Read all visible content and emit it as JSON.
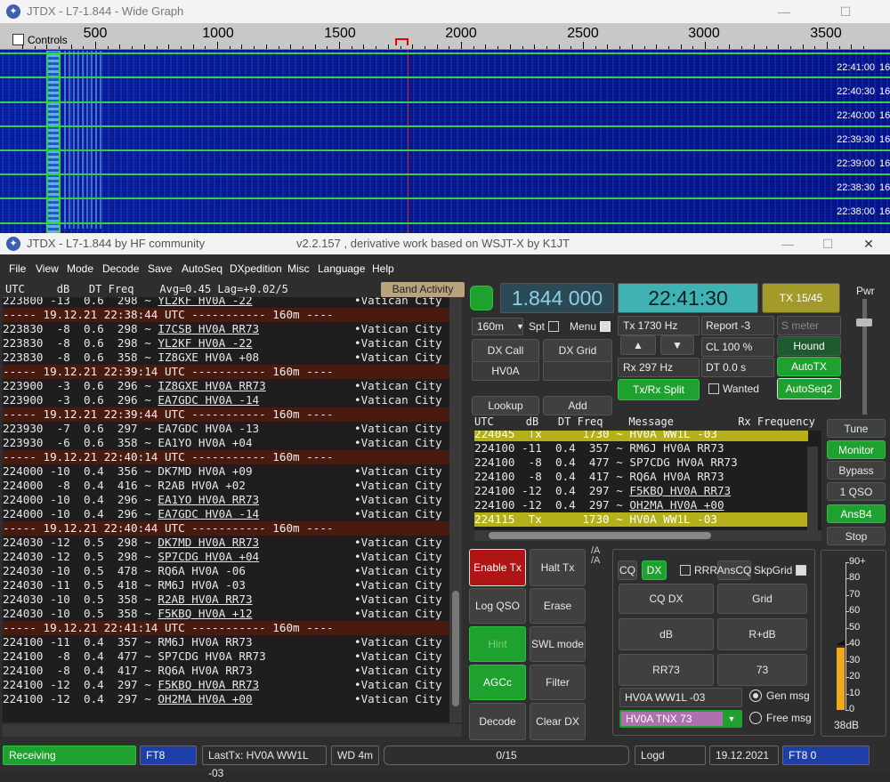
{
  "wide_graph": {
    "title": "JTDX - L7-1.844 - Wide Graph",
    "controls_label": "Controls",
    "scale_labels": [
      "500",
      "1000",
      "1500",
      "2000",
      "2500",
      "3000",
      "3500"
    ],
    "times": [
      "22:41:00",
      "22:40:30",
      "22:40:00",
      "22:39:30",
      "22:39:00",
      "22:38:30",
      "22:38:00"
    ],
    "time_suffix": "16"
  },
  "main": {
    "title": "JTDX - L7-1.844  by HF community",
    "version": "v2.2.157 , derivative work based on WSJT-X by K1JT",
    "menu": [
      "File",
      "View",
      "Mode",
      "Decode",
      "Save",
      "AutoSeq",
      "DXpedition",
      "Misc",
      "Language",
      "Help"
    ],
    "left_header": "UTC     dB   DT Freq    Avg=0.45 Lag=+0.02/5",
    "band_activity": "Band Activity",
    "left_rows": [
      {
        "t": "line",
        "text": "223800 -13  0.6  298 ~ ",
        "msg": "YL2KF HV0A -22",
        "cty": "•Vatican City"
      },
      {
        "t": "sep",
        "text": "----- 19.12.21 22:38:44 UTC ----------- 160m ----"
      },
      {
        "t": "line",
        "text": "223830  -8  0.6  298 ~ ",
        "msg": "I7CSB HV0A RR73",
        "cty": "•Vatican City"
      },
      {
        "t": "line",
        "text": "223830  -8  0.6  298 ~ ",
        "msg": "YL2KF HV0A -22",
        "cty": "•Vatican City"
      },
      {
        "t": "line",
        "text": "223830  -8  0.6  358 ~ IZ8GXE HV0A +08",
        "msg": "",
        "cty": "•Vatican City"
      },
      {
        "t": "sep",
        "text": "----- 19.12.21 22:39:14 UTC ----------- 160m ----"
      },
      {
        "t": "line",
        "text": "223900  -3  0.6  296 ~ ",
        "msg": "IZ8GXE HV0A RR73",
        "cty": "•Vatican City"
      },
      {
        "t": "line",
        "text": "223900  -3  0.6  296 ~ ",
        "msg": "EA7GDC HV0A -14",
        "cty": "•Vatican City"
      },
      {
        "t": "sep",
        "text": "----- 19.12.21 22:39:44 UTC ----------- 160m ----"
      },
      {
        "t": "line",
        "text": "223930  -7  0.6  297 ~ EA7GDC HV0A -13",
        "msg": "",
        "cty": "•Vatican City"
      },
      {
        "t": "line",
        "text": "223930  -6  0.6  358 ~ EA1YO HV0A +04",
        "msg": "",
        "cty": "•Vatican City"
      },
      {
        "t": "sep",
        "text": "----- 19.12.21 22:40:14 UTC ----------- 160m ----"
      },
      {
        "t": "line",
        "text": "224000 -10  0.4  356 ~ DK7MD HV0A +09",
        "msg": "",
        "cty": "•Vatican City"
      },
      {
        "t": "line",
        "text": "224000  -8  0.4  416 ~ R2AB HV0A +02",
        "msg": "",
        "cty": "•Vatican City"
      },
      {
        "t": "line",
        "text": "224000 -10  0.4  296 ~ ",
        "msg": "EA1YO HV0A RR73",
        "cty": "•Vatican City"
      },
      {
        "t": "line",
        "text": "224000 -10  0.4  296 ~ ",
        "msg": "EA7GDC HV0A -14",
        "cty": "•Vatican City"
      },
      {
        "t": "sep",
        "text": "----- 19.12.21 22:40:44 UTC ----------- 160m ----"
      },
      {
        "t": "line",
        "text": "224030 -12  0.5  298 ~ ",
        "msg": "DK7MD HV0A RR73",
        "cty": "•Vatican City"
      },
      {
        "t": "line",
        "text": "224030 -12  0.5  298 ~ ",
        "msg": "SP7CDG HV0A +04",
        "cty": "•Vatican City"
      },
      {
        "t": "line",
        "text": "224030 -10  0.5  478 ~ RQ6A HV0A -06",
        "msg": "",
        "cty": "•Vatican City"
      },
      {
        "t": "line",
        "text": "224030 -11  0.5  418 ~ RM6J HV0A -03",
        "msg": "",
        "cty": "•Vatican City"
      },
      {
        "t": "line",
        "text": "224030 -10  0.5  358 ~ ",
        "msg": "R2AB HV0A RR73",
        "cty": "•Vatican City"
      },
      {
        "t": "line",
        "text": "224030 -10  0.5  358 ~ ",
        "msg": "F5KBQ HV0A +12",
        "cty": "•Vatican City"
      },
      {
        "t": "sep",
        "text": "----- 19.12.21 22:41:14 UTC ----------- 160m ----"
      },
      {
        "t": "line",
        "text": "224100 -11  0.4  357 ~ RM6J HV0A RR73",
        "msg": "",
        "cty": "•Vatican City"
      },
      {
        "t": "line",
        "text": "224100  -8  0.4  477 ~ SP7CDG HV0A RR73",
        "msg": "",
        "cty": "•Vatican City"
      },
      {
        "t": "line",
        "text": "224100  -8  0.4  417 ~ RQ6A HV0A RR73",
        "msg": "",
        "cty": "•Vatican City"
      },
      {
        "t": "line",
        "text": "224100 -12  0.4  297 ~ ",
        "msg": "F5KBQ HV0A RR73",
        "cty": "•Vatican City"
      },
      {
        "t": "line",
        "text": "224100 -12  0.4  297 ~ ",
        "msg": "OH2MA HV0A +00",
        "cty": "•Vatican City"
      }
    ],
    "freq_display": "1.844 000",
    "time_display": "22:41:30",
    "tx_period": "TX 15/45",
    "pwr_label": "Pwr",
    "band": "160m",
    "spt_label": "Spt",
    "menu_label": "Menu",
    "tx_freq": "Tx  1730  Hz",
    "report": "Report -3",
    "s_meter": "S meter",
    "dx_call_btn": "DX Call",
    "dx_grid_btn": "DX Grid",
    "dx_call_value": "HV0A",
    "up_arrow": "▲",
    "down_arrow": "▼",
    "cl": "CL  100 %",
    "hound": "Hound",
    "rx_freq": "Rx  297  Hz",
    "dt": "DT 0.0 s",
    "autotx": "AutoTX",
    "lookup": "Lookup",
    "add": "Add",
    "txrx_split": "Tx/Rx Split",
    "wanted": "Wanted",
    "autoseq2": "AutoSeq2",
    "rx_header": "UTC     dB   DT Freq    Message          Rx Frequency",
    "rx_rows": [
      {
        "t": "tx",
        "text": "224045  Tx      1730 ~ HV0A WW1L -03",
        "msg": ""
      },
      {
        "t": "line",
        "text": "224100 -11  0.4  357 ~ RM6J HV0A RR73",
        "msg": ""
      },
      {
        "t": "line",
        "text": "224100  -8  0.4  477 ~ SP7CDG HV0A RR73",
        "msg": ""
      },
      {
        "t": "line",
        "text": "224100  -8  0.4  417 ~ RQ6A HV0A RR73",
        "msg": ""
      },
      {
        "t": "line",
        "text": "224100 -12  0.4  297 ~ ",
        "msg": "F5KBQ HV0A RR73"
      },
      {
        "t": "line",
        "text": "224100 -12  0.4  297 ~ ",
        "msg": "OH2MA HV0A +00"
      },
      {
        "t": "tx",
        "text": "224115  Tx      1730 ~ HV0A WW1L -03",
        "msg": ""
      }
    ],
    "side_buttons": [
      "Tune",
      "Monitor",
      "Bypass",
      "1 QSO",
      "AnsB4",
      "Stop"
    ],
    "enable_tx": "Enable Tx",
    "halt_tx": "Halt Tx",
    "log_qso": "Log QSO",
    "erase": "Erase",
    "hint": "Hint",
    "swl_mode": "SWL mode",
    "agcc": "AGCc",
    "filter": "Filter",
    "decode": "Decode",
    "clear_dx": "Clear DX",
    "cq": "CQ",
    "dx": "DX",
    "rrr": "RRR",
    "anscq": "AnsCQ",
    "skpgrid": "SkpGrid",
    "cq_dx": "CQ DX",
    "grid": "Grid",
    "db": "dB",
    "r_db": "R+dB",
    "rr73": "RR73",
    "seventy_three": "73",
    "tx_msg_field": "HV0A WW1L -03",
    "gen_msg": "Gen msg",
    "free_msg_value": "HV0A TNX 73",
    "free_msg": "Free msg",
    "meter_labels": [
      "90+",
      "80",
      "70",
      "60",
      "50",
      "40",
      "30",
      "20",
      "10",
      "0"
    ],
    "meter_value_label": "38dB",
    "meter_level_db": 38,
    "status": {
      "receiving": "Receiving",
      "mode": "FT8",
      "last_tx": "LastTx: HV0A WW1L -03",
      "wd": "WD 4m",
      "progress": "0/15",
      "logd": "Logd",
      "date": "19.12.2021",
      "mode2": "FT8  0"
    },
    "colors": {
      "green": "#1ea12e",
      "red": "#b01515",
      "olive": "#a49a2a",
      "cyan_time": "#3fb3b3",
      "freq_bg": "#2b4a55",
      "freq_fg": "#8fd0e8",
      "meter": "#f0a81c",
      "blue_status": "#1f3fa8"
    }
  }
}
